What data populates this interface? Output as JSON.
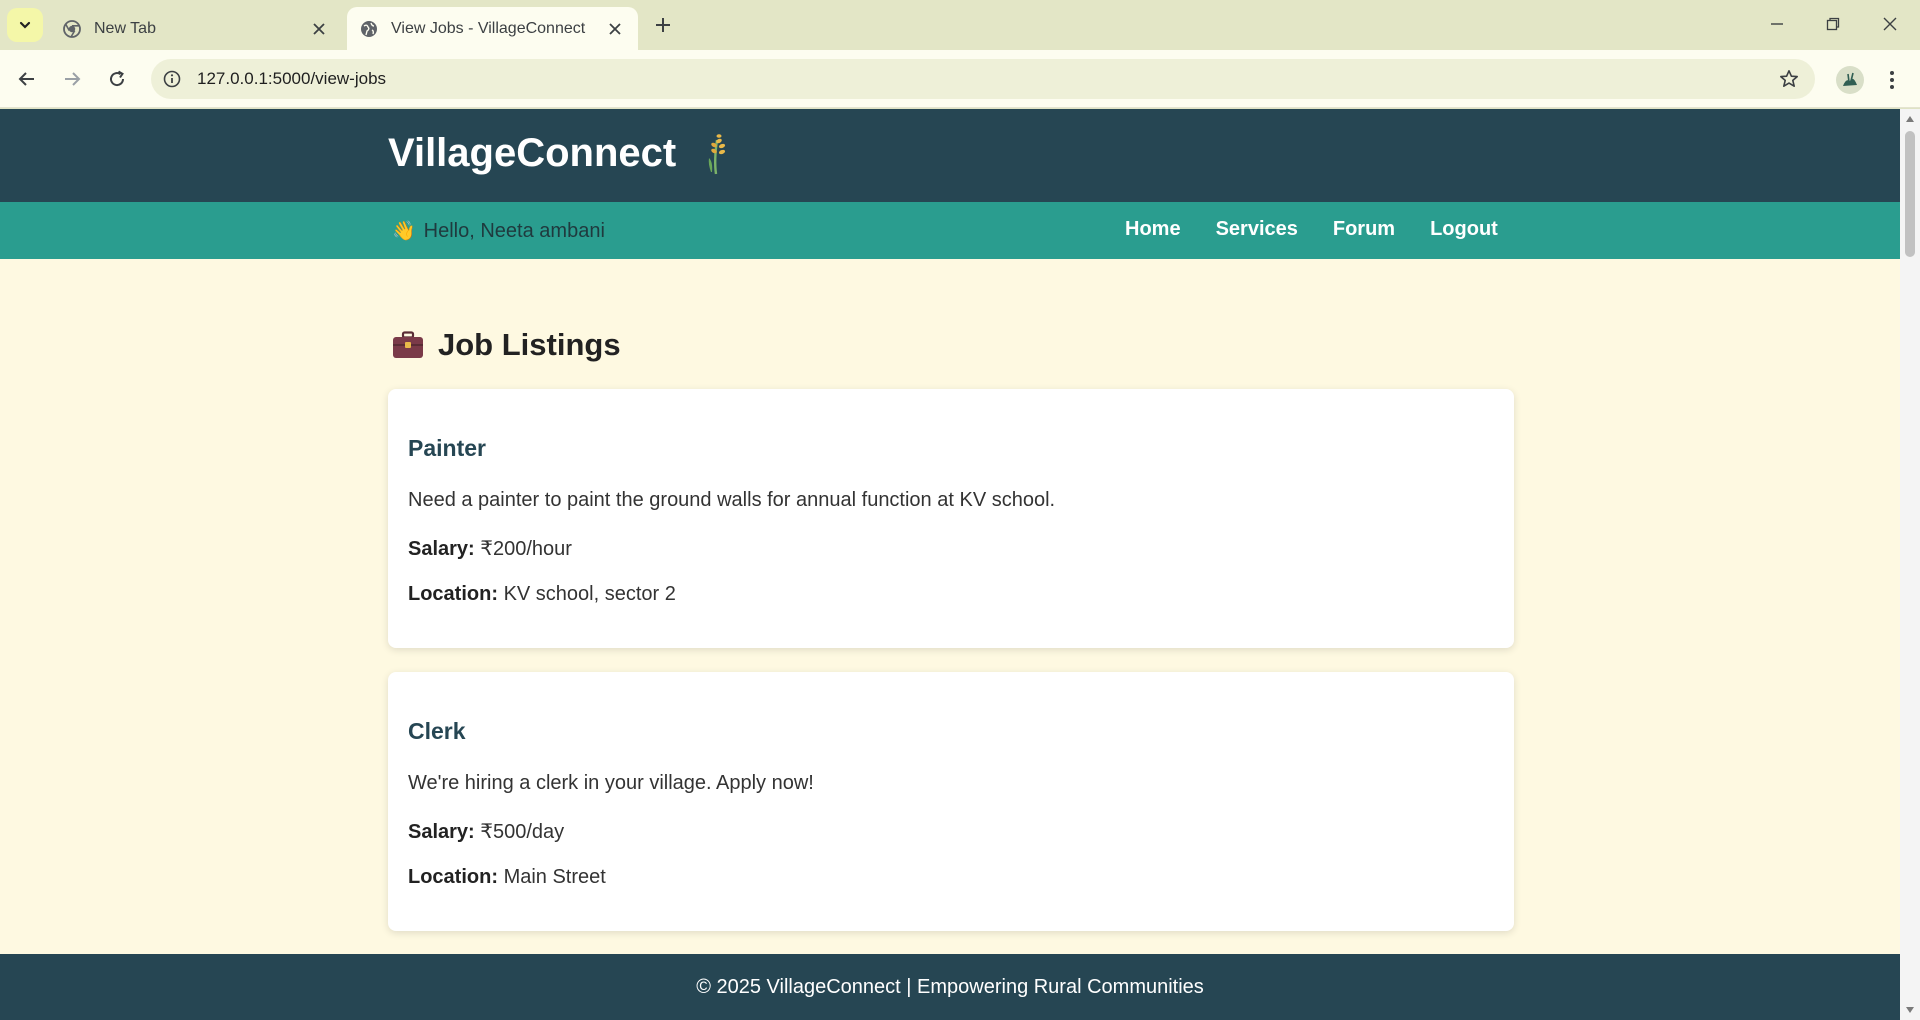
{
  "browser": {
    "tabs": [
      {
        "title": "New Tab",
        "active": false,
        "icon": "chrome-icon"
      },
      {
        "title": "View Jobs - VillageConnect",
        "active": true,
        "icon": "globe-icon"
      }
    ],
    "url": "127.0.0.1:5000/view-jobs"
  },
  "site": {
    "brand": "VillageConnect",
    "brand_icon": "wheat-icon",
    "greeting_icon": "👋",
    "greeting": "Hello, Neeta ambani",
    "nav": [
      "Home",
      "Services",
      "Forum",
      "Logout"
    ],
    "colors": {
      "header": "#264653",
      "nav": "#2a9d8f",
      "background": "#fef9e1"
    }
  },
  "main": {
    "title": "Job Listings",
    "title_icon": "briefcase-icon",
    "salary_label": "Salary:",
    "location_label": "Location:",
    "jobs": [
      {
        "title": "Painter",
        "description": "Need a painter to paint the ground walls for annual function at KV school.",
        "salary": "₹200/hour",
        "location": "KV school, sector 2"
      },
      {
        "title": "Clerk",
        "description": "We're hiring a clerk in your village. Apply now!",
        "salary": "₹500/day",
        "location": "Main Street"
      }
    ]
  },
  "footer": {
    "text": "© 2025 VillageConnect | Empowering Rural Communities"
  }
}
